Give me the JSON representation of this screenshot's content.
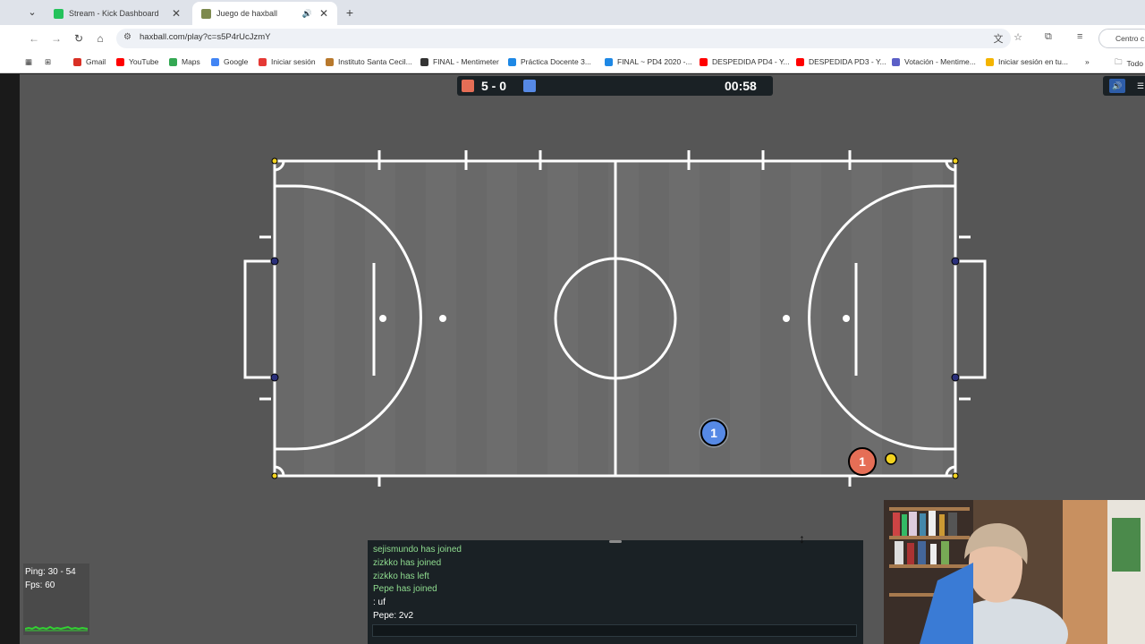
{
  "tabs": [
    {
      "title": "Stream - Kick Dashboard",
      "favicon_color": "#24c25b",
      "active": false
    },
    {
      "title": "Juego de haxball",
      "favicon_color": "#7d8a4e",
      "active": true
    }
  ],
  "address": {
    "url": "haxball.com/play?c=s5P4rUcJzmY"
  },
  "profile_chip_label": "Centro c",
  "bookmarks": [
    {
      "label": "Gmail",
      "color": "#d93025"
    },
    {
      "label": "YouTube",
      "color": "#ff0000"
    },
    {
      "label": "Maps",
      "color": "#34a853"
    },
    {
      "label": "Google",
      "color": "#4285f4"
    },
    {
      "label": "Iniciar sesión",
      "color": "#e53935"
    },
    {
      "label": "Instituto Santa Cecil...",
      "color": "#b8792d"
    },
    {
      "label": "FINAL - Mentimeter",
      "color": "#333333"
    },
    {
      "label": "Práctica Docente 3...",
      "color": "#1e88e5"
    },
    {
      "label": "FINAL ~ PD4 2020 -...",
      "color": "#1e88e5"
    },
    {
      "label": "DESPEDIDA PD4 - Y...",
      "color": "#ff0000"
    },
    {
      "label": "DESPEDIDA PD3 - Y...",
      "color": "#ff0000"
    },
    {
      "label": "Votación - Mentime...",
      "color": "#5b5fc7"
    },
    {
      "label": "Iniciar sesión en tu...",
      "color": "#f4b400"
    }
  ],
  "bookmarks_folder": "Todo",
  "scoreboard": {
    "red_score": 5,
    "blue_score": 0,
    "score_text": "5 - 0",
    "time": "00:58",
    "red_color": "#e56e56",
    "blue_color": "#5689e5"
  },
  "players": [
    {
      "team": "blue",
      "number": "1",
      "color": "#5689e5"
    },
    {
      "team": "red",
      "number": "1",
      "color": "#e56e56"
    }
  ],
  "ball_color": "#f2d21f",
  "stats": {
    "ping": "Ping: 30 - 54",
    "fps": "Fps: 60"
  },
  "chat": {
    "messages": [
      {
        "text": "sejismundo has joined",
        "kind": "notice"
      },
      {
        "text": "zizkko has joined",
        "kind": "notice"
      },
      {
        "text": "zizkko has left",
        "kind": "notice"
      },
      {
        "text": "Pepe has joined",
        "kind": "notice"
      },
      {
        "text": ": uf",
        "kind": "user"
      },
      {
        "text": "Pepe: 2v2",
        "kind": "user"
      }
    ],
    "input_value": ""
  }
}
